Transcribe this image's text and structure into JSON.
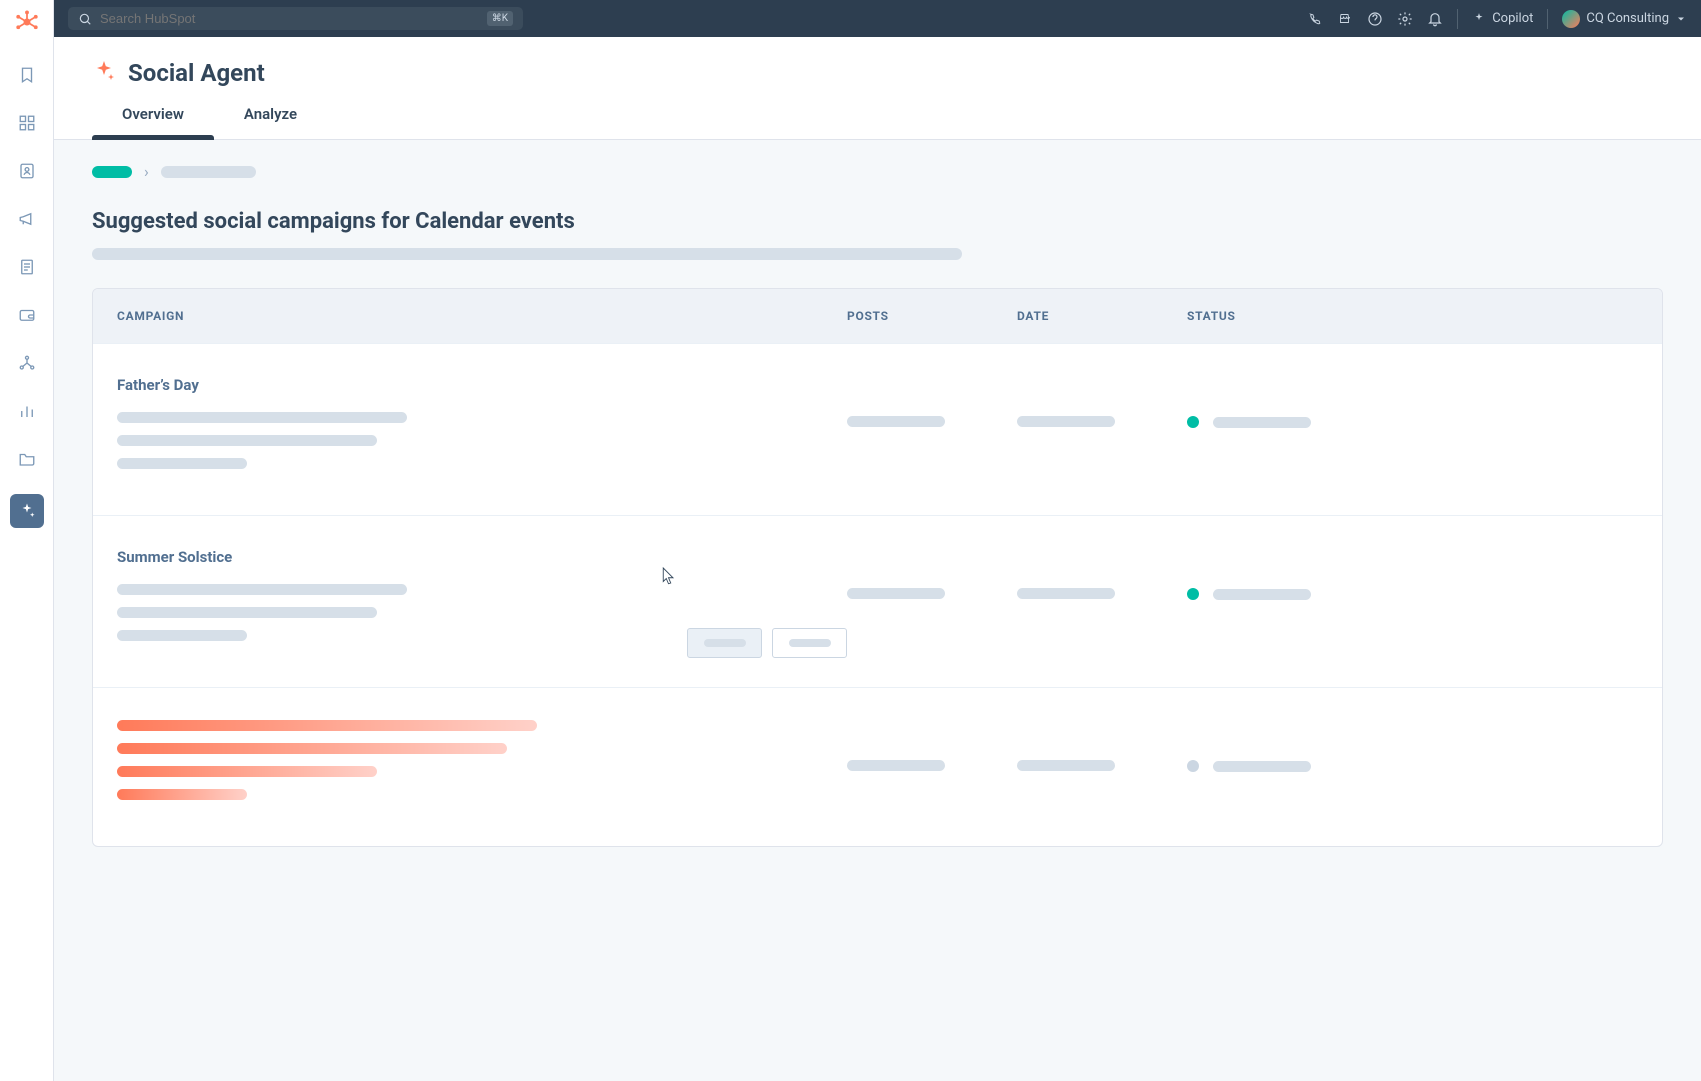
{
  "topbar": {
    "search_placeholder": "Search HubSpot",
    "kbd": "⌘K",
    "copilot_label": "Copilot",
    "account_name": "CQ Consulting"
  },
  "page": {
    "title": "Social Agent",
    "tabs": [
      {
        "label": "Overview",
        "active": true
      },
      {
        "label": "Analyze",
        "active": false
      }
    ],
    "section_heading": "Suggested social campaigns for Calendar events"
  },
  "table": {
    "headers": {
      "campaign": "CAMPAIGN",
      "posts": "POSTS",
      "date": "DATE",
      "status": "STATUS"
    },
    "rows": [
      {
        "title": "Father’s Day",
        "status_color": "teal"
      },
      {
        "title": "Summer Solstice",
        "status_color": "teal",
        "show_buttons": true
      },
      {
        "title": "",
        "status_color": "gray",
        "orange": true
      }
    ]
  },
  "icons": {
    "brand": "hubspot-sprocket",
    "rail": [
      "bookmark-icon",
      "grid-icon",
      "contacts-icon",
      "megaphone-icon",
      "document-icon",
      "wallet-icon",
      "org-icon",
      "chart-icon",
      "folder-icon",
      "sparkle-icon"
    ],
    "top": [
      "phone-icon",
      "store-icon",
      "help-icon",
      "settings-icon",
      "bell-icon"
    ]
  }
}
